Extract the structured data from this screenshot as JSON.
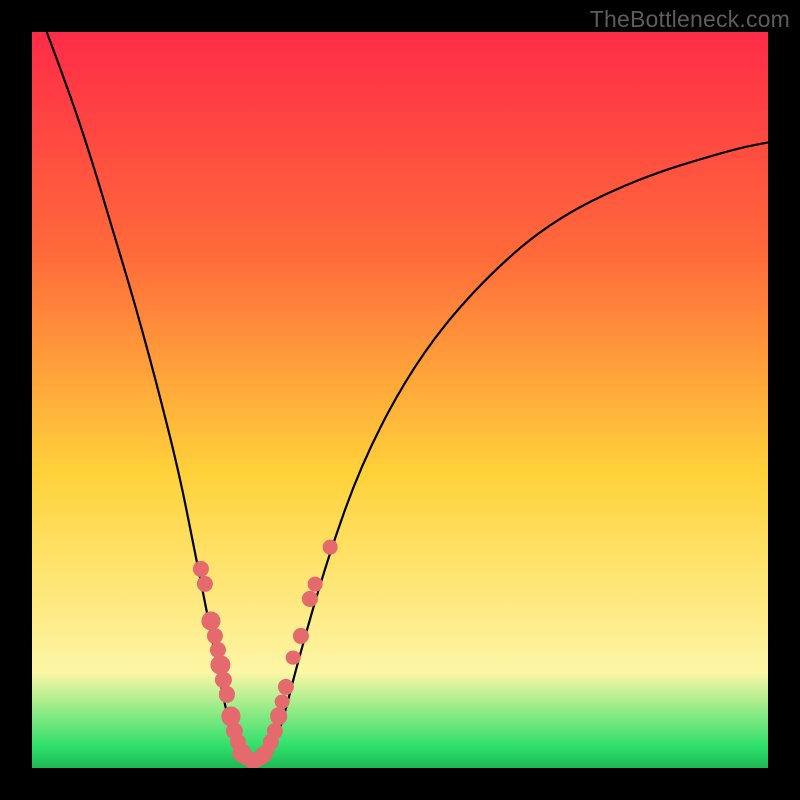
{
  "watermark": "TheBottleneck.com",
  "colors": {
    "frame": "#000000",
    "grad_top": "#ff2b48",
    "grad_upper_mid": "#ff6a3a",
    "grad_mid": "#ffd23a",
    "grad_pale": "#fdf6a6",
    "grad_green": "#2fe06a",
    "curve": "#000000",
    "dot": "#e46a6d"
  },
  "chart_data": {
    "type": "line",
    "title": "",
    "xlabel": "",
    "ylabel": "",
    "xlim": [
      0,
      100
    ],
    "ylim": [
      0,
      100
    ],
    "series": [
      {
        "name": "bottleneck-curve",
        "x": [
          2,
          5,
          8,
          11,
          14,
          17,
          20,
          22,
          24,
          25.5,
          27,
          28.5,
          30,
          32,
          34,
          36,
          40,
          45,
          52,
          60,
          70,
          82,
          95,
          100
        ],
        "y": [
          100,
          92,
          83,
          73,
          63,
          52,
          40,
          30,
          20,
          12,
          5,
          1,
          0,
          1,
          6,
          14,
          28,
          42,
          55,
          65,
          74,
          80,
          84,
          85
        ]
      }
    ],
    "markers": [
      {
        "x": 23.0,
        "y": 27.0,
        "r": 1.1
      },
      {
        "x": 23.5,
        "y": 25.0,
        "r": 1.1
      },
      {
        "x": 24.3,
        "y": 20.0,
        "r": 1.3
      },
      {
        "x": 24.8,
        "y": 18.0,
        "r": 1.1
      },
      {
        "x": 25.3,
        "y": 16.0,
        "r": 1.1
      },
      {
        "x": 25.6,
        "y": 14.0,
        "r": 1.3
      },
      {
        "x": 26.0,
        "y": 12.0,
        "r": 1.1
      },
      {
        "x": 26.5,
        "y": 10.0,
        "r": 1.1
      },
      {
        "x": 27.0,
        "y": 7.0,
        "r": 1.3
      },
      {
        "x": 27.5,
        "y": 5.0,
        "r": 1.1
      },
      {
        "x": 28.0,
        "y": 3.5,
        "r": 1.1
      },
      {
        "x": 28.5,
        "y": 2.0,
        "r": 1.3
      },
      {
        "x": 29.0,
        "y": 1.5,
        "r": 1.0
      },
      {
        "x": 29.5,
        "y": 1.2,
        "r": 1.0
      },
      {
        "x": 30.0,
        "y": 1.0,
        "r": 1.2
      },
      {
        "x": 30.5,
        "y": 1.0,
        "r": 1.0
      },
      {
        "x": 31.0,
        "y": 1.3,
        "r": 1.0
      },
      {
        "x": 31.5,
        "y": 1.8,
        "r": 1.2
      },
      {
        "x": 32.0,
        "y": 2.5,
        "r": 1.0
      },
      {
        "x": 32.5,
        "y": 3.5,
        "r": 1.1
      },
      {
        "x": 33.0,
        "y": 5.0,
        "r": 1.1
      },
      {
        "x": 33.5,
        "y": 7.0,
        "r": 1.2
      },
      {
        "x": 34.0,
        "y": 9.0,
        "r": 1.0
      },
      {
        "x": 34.5,
        "y": 11.0,
        "r": 1.1
      },
      {
        "x": 35.5,
        "y": 15.0,
        "r": 1.0
      },
      {
        "x": 36.5,
        "y": 18.0,
        "r": 1.1
      },
      {
        "x": 37.8,
        "y": 23.0,
        "r": 1.1
      },
      {
        "x": 38.5,
        "y": 25.0,
        "r": 1.0
      },
      {
        "x": 40.5,
        "y": 30.0,
        "r": 1.0
      }
    ]
  }
}
